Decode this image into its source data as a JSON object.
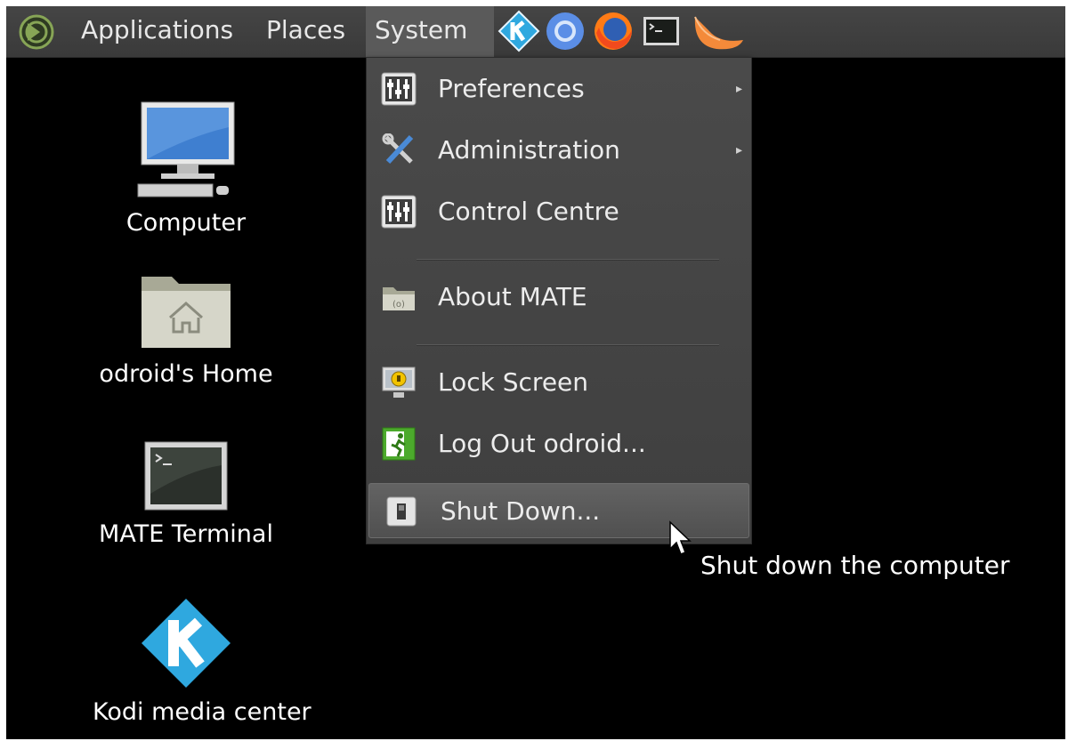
{
  "panel": {
    "menus": [
      {
        "label": "Applications"
      },
      {
        "label": "Places"
      },
      {
        "label": "System"
      }
    ],
    "launchers": [
      "kodi-icon",
      "chromium-icon",
      "firefox-icon",
      "terminal-icon",
      "clementine-icon"
    ]
  },
  "desktop": {
    "icons": [
      {
        "label": "Computer",
        "icon": "computer-icon"
      },
      {
        "label": "odroid's Home",
        "icon": "home-folder-icon"
      },
      {
        "label": "MATE Terminal",
        "icon": "terminal-icon"
      },
      {
        "label": "Kodi media center",
        "icon": "kodi-icon"
      }
    ]
  },
  "system_menu": {
    "items": [
      {
        "label": "Preferences",
        "icon": "preferences-icon",
        "submenu": true
      },
      {
        "label": "Administration",
        "icon": "administration-icon",
        "submenu": true
      },
      {
        "label": "Control Centre",
        "icon": "control-centre-icon",
        "submenu": false
      },
      {
        "label": "About MATE",
        "icon": "about-mate-icon",
        "submenu": false
      },
      {
        "label": "Lock Screen",
        "icon": "lock-screen-icon",
        "submenu": false
      },
      {
        "label": "Log Out odroid...",
        "icon": "log-out-icon",
        "submenu": false
      },
      {
        "label": "Shut Down...",
        "icon": "shut-down-icon",
        "submenu": false,
        "highlighted": true
      }
    ],
    "submenu_arrow": "▸"
  },
  "tooltip": {
    "text": "Shut down the computer"
  },
  "colors": {
    "panel": "#3e3e3e",
    "menu": "#454545",
    "desktop": "#000000",
    "highlight": "#5a5a5a"
  }
}
